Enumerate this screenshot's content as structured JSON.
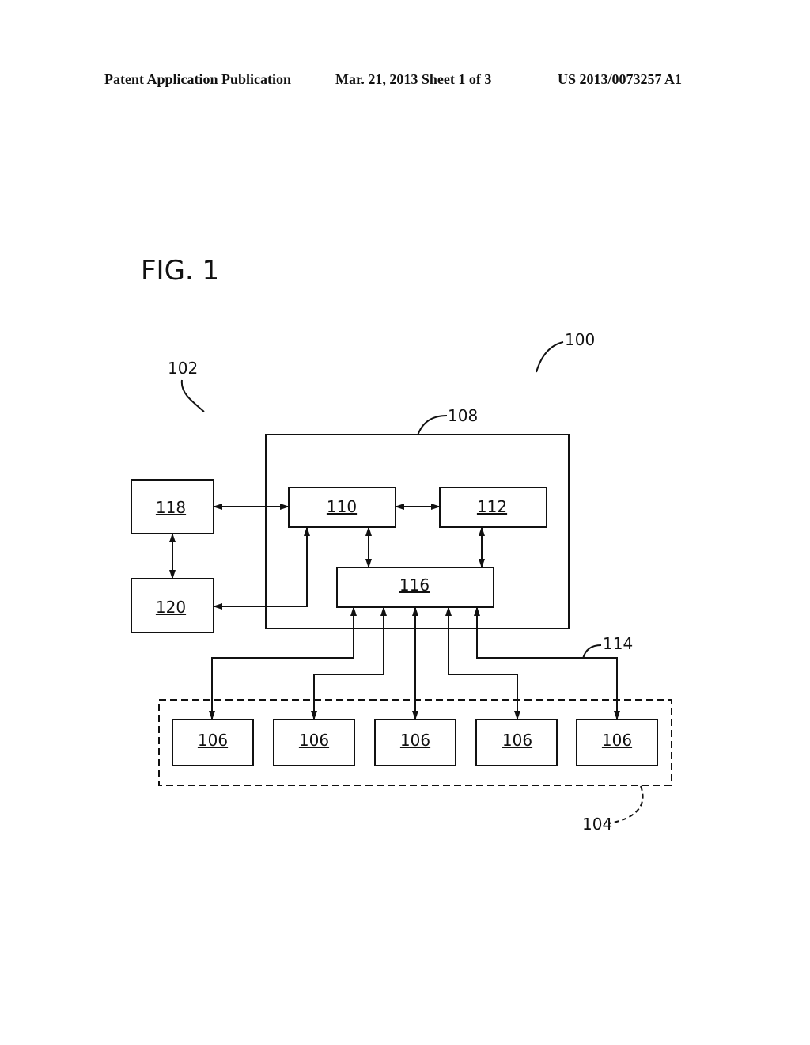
{
  "header": {
    "left": "Patent Application Publication",
    "middle": "Mar. 21, 2013  Sheet 1 of 3",
    "right": "US 2013/0073257 A1"
  },
  "figure": {
    "title": "FIG. 1",
    "refs": {
      "system": "100",
      "subsystem": "102",
      "group": "104",
      "controller": "108",
      "bus": "114"
    },
    "boxes": {
      "b110": "110",
      "b112": "112",
      "b116": "116",
      "b118": "118",
      "b120": "120",
      "devices": [
        "106",
        "106",
        "106",
        "106",
        "106"
      ]
    }
  }
}
